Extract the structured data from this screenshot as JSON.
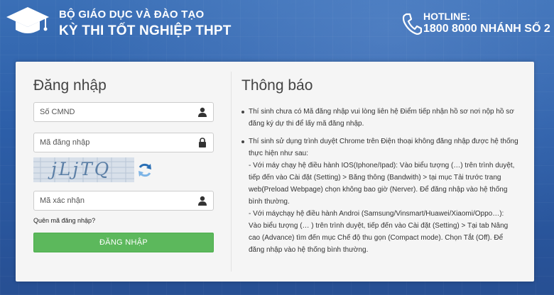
{
  "header": {
    "org_name": "BỘ GIÁO DỤC VÀ ĐÀO TẠO",
    "exam_name": "KỲ THI TỐT NGHIỆP THPT",
    "hotline_label": "HOTLINE:",
    "hotline_number": "1800 8000 NHÁNH SỐ 2"
  },
  "login": {
    "title": "Đăng nhập",
    "id_placeholder": "Số CMND",
    "code_placeholder": "Mã đăng nhập",
    "captcha_text": "jLjTQ",
    "captcha_input_placeholder": "Mã xác nhận",
    "forgot_link": "Quên mã đăng nhập?",
    "submit_label": "ĐĂNG NHẬP"
  },
  "notice": {
    "title": "Thông báo",
    "items": [
      {
        "lines": [
          "Thí sinh chưa có Mã đăng nhập vui lòng liên hệ Điểm tiếp nhận hồ sơ nơi nộp hồ sơ",
          "đăng ký dự thi để lấy mã đăng nhập."
        ]
      },
      {
        "lines": [
          "Thí sinh sử dụng trình duyệt Chrome trên Điện thoại không đăng nhập được hệ thống",
          "thực hiện như sau:",
          " - Với máy chạy hệ điều hành IOS(Iphone/Ipad): Vào biểu tượng (…) trên trình duyệt,",
          "tiếp đến vào Cài đặt (Setting) > Băng thông (Bandwith) > tại mục Tải trước trang",
          "web(Preload Webpage) chọn không bao giờ (Nerver). Để đăng nhập vào hệ thống",
          "bình thường.",
          " - Với máychạy hệ điều hành Androi (Samsung/Vinsmart/Huawei/Xiaomi/Oppo…):",
          "Vào biểu tượng (… ) trên trình duyệt, tiếp đến vào Cài đặt (Setting) > Tại tab Nâng",
          "cao (Advance) tìm đến mục Chế độ thu gọn (Compact mode). Chọn Tắt (Off). Để",
          "đăng nhập vào hệ thống bình thường."
        ]
      }
    ]
  },
  "colors": {
    "background": "#2c5ea8",
    "login_button": "#5cb85c",
    "panel": "#f5f5f5"
  },
  "icons": {
    "logo": "graduation-cap-icon",
    "hotline": "phone-icon",
    "id_field": "user-icon",
    "code_field": "lock-icon",
    "captcha_refresh": "refresh-icon",
    "captcha_field": "user-icon"
  }
}
